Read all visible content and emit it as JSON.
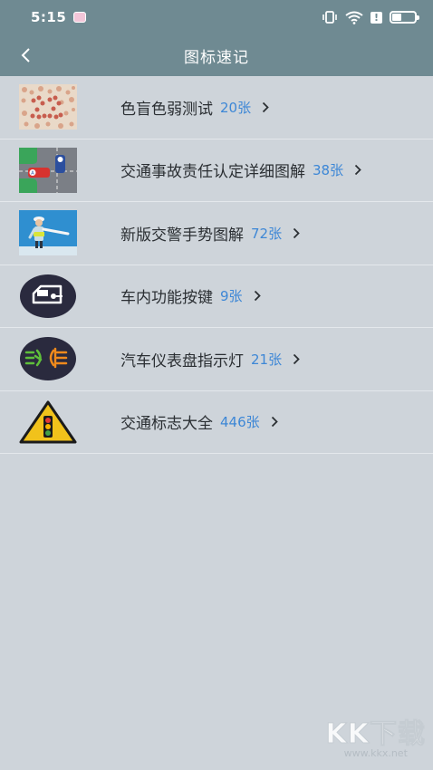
{
  "status_bar": {
    "time": "5:15"
  },
  "header": {
    "title": "图标速记"
  },
  "items": [
    {
      "label": "色盲色弱测试",
      "count": "20张"
    },
    {
      "label": "交通事故责任认定详细图解",
      "count": "38张"
    },
    {
      "label": "新版交警手势图解",
      "count": "72张"
    },
    {
      "label": "车内功能按键",
      "count": "9张"
    },
    {
      "label": "汽车仪表盘指示灯",
      "count": "21张"
    },
    {
      "label": "交通标志大全",
      "count": "446张"
    }
  ],
  "watermark": {
    "main": "KK下载",
    "sub": "www.kkx.net"
  },
  "colors": {
    "header_bg": "#6f8a92",
    "page_bg": "#ced4da",
    "count_text": "#3d87d6"
  },
  "icons": [
    "color-blind-test-thumb",
    "accident-diagram-thumb",
    "police-gesture-thumb",
    "car-door-button-thumb",
    "dashboard-light-thumb",
    "traffic-light-sign-thumb"
  ]
}
